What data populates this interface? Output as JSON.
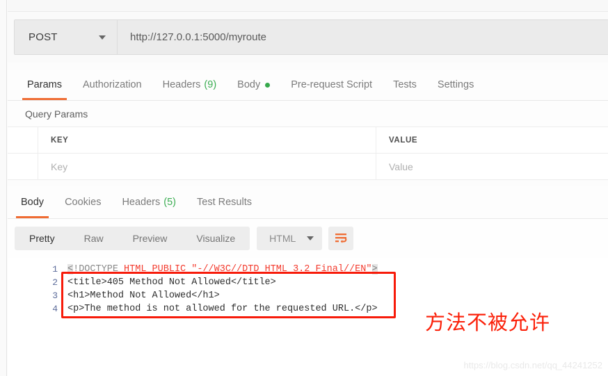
{
  "request": {
    "method": "POST",
    "url": "http://127.0.0.1:5000/myroute",
    "tabs": [
      {
        "label": "Params",
        "count": "",
        "dot": false,
        "active": true
      },
      {
        "label": "Authorization",
        "count": "",
        "dot": false,
        "active": false
      },
      {
        "label": "Headers",
        "count": "(9)",
        "dot": false,
        "active": false
      },
      {
        "label": "Body",
        "count": "",
        "dot": true,
        "active": false
      },
      {
        "label": "Pre-request Script",
        "count": "",
        "dot": false,
        "active": false
      },
      {
        "label": "Tests",
        "count": "",
        "dot": false,
        "active": false
      },
      {
        "label": "Settings",
        "count": "",
        "dot": false,
        "active": false
      }
    ]
  },
  "query_params": {
    "section_title": "Query Params",
    "headers": {
      "key": "KEY",
      "value": "VALUE"
    },
    "rows": [
      {
        "key_placeholder": "Key",
        "value_placeholder": "Value"
      }
    ]
  },
  "response": {
    "tabs": [
      {
        "label": "Body",
        "count": "",
        "active": true
      },
      {
        "label": "Cookies",
        "count": "",
        "active": false
      },
      {
        "label": "Headers",
        "count": "(5)",
        "active": false
      },
      {
        "label": "Test Results",
        "count": "",
        "active": false
      }
    ],
    "view_modes": [
      {
        "label": "Pretty",
        "active": true
      },
      {
        "label": "Raw",
        "active": false
      },
      {
        "label": "Preview",
        "active": false
      },
      {
        "label": "Visualize",
        "active": false
      }
    ],
    "format": "HTML",
    "wrap_icon": "word-wrap-icon",
    "body_lines": [
      {
        "num": "1",
        "segments": [
          {
            "text": "<",
            "cls": "sel-hl"
          },
          {
            "text": "!DOCTYPE ",
            "cls": "tok-gray"
          },
          {
            "text": "HTML PUBLIC \"-//W3C//DTD HTML 3.2 Final//EN\"",
            "cls": "tok-red"
          },
          {
            "text": ">",
            "cls": "sel-hl"
          }
        ]
      },
      {
        "num": "2",
        "segments": [
          {
            "text": "<title>405 Method Not Allowed</title>",
            "cls": "tok-dark"
          }
        ]
      },
      {
        "num": "3",
        "segments": [
          {
            "text": "<h1>Method Not Allowed</h1>",
            "cls": "tok-dark"
          }
        ]
      },
      {
        "num": "4",
        "segments": [
          {
            "text": "<p>The method is not allowed for the requested URL.</p>",
            "cls": "tok-dark"
          }
        ]
      }
    ]
  },
  "annotations": {
    "chinese_note": "方法不被允许",
    "highlight_color": "#f71b0a",
    "note_color": "#fb2009"
  },
  "watermark": "https://blog.csdn.net/qq_44241252",
  "theme": {
    "accent": "#ef6c33",
    "green": "#3bad52",
    "bg": "#fcfcfc"
  }
}
